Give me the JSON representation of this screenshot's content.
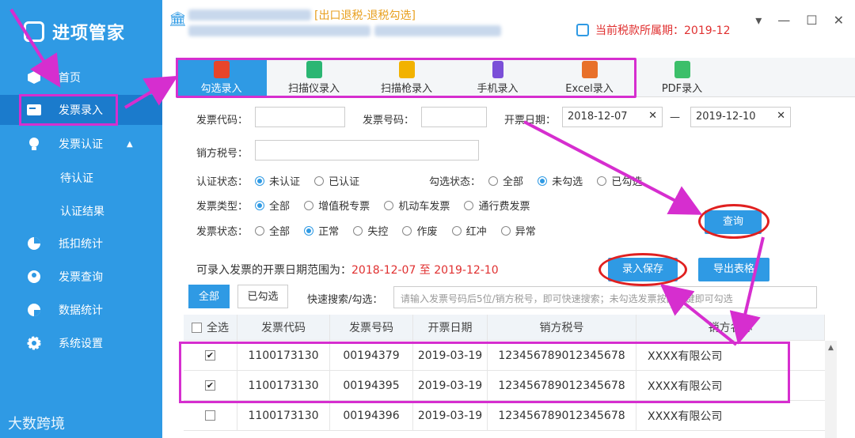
{
  "app": {
    "title": "进项管家",
    "watermark": "大数跨境"
  },
  "sidebar": {
    "items": [
      {
        "label": "首页",
        "icon": "cube-icon"
      },
      {
        "label": "发票录入",
        "icon": "invoice-icon"
      },
      {
        "label": "发票认证",
        "icon": "bulb-icon"
      },
      {
        "label": "待认证"
      },
      {
        "label": "认证结果"
      },
      {
        "label": "抵扣统计",
        "icon": "pie-icon"
      },
      {
        "label": "发票查询",
        "icon": "user-icon"
      },
      {
        "label": "数据统计",
        "icon": "chart-icon"
      },
      {
        "label": "系统设置",
        "icon": "gear-icon"
      }
    ]
  },
  "header": {
    "company_tag": "[出口退税-退税勾选]",
    "period_label": "当前税款所属期：",
    "period_value": "2019-12"
  },
  "tabs": [
    {
      "label": "勾选录入",
      "color": "#e8452a"
    },
    {
      "label": "扫描仪录入",
      "color": "#2bb673"
    },
    {
      "label": "扫描枪录入",
      "color": "#f2b200"
    },
    {
      "label": "手机录入",
      "color": "#7b4fd8"
    },
    {
      "label": "Excel录入",
      "color": "#e8702a"
    },
    {
      "label": "PDF录入",
      "color": "#3cbf6a"
    }
  ],
  "filters": {
    "invoice_code_label": "发票代码：",
    "invoice_no_label": "发票号码：",
    "date_label": "开票日期：",
    "date_from": "2018-12-07",
    "date_to": "2019-12-10",
    "date_sep": "—",
    "seller_tax_label": "销方税号：",
    "auth_status_label": "认证状态：",
    "auth_options": [
      "未认证",
      "已认证"
    ],
    "check_status_label": "勾选状态：",
    "check_options": [
      "全部",
      "未勾选",
      "已勾选"
    ],
    "type_label": "发票类型：",
    "type_options": [
      "全部",
      "增值税专票",
      "机动车发票",
      "通行费发票"
    ],
    "state_label": "发票状态：",
    "state_options": [
      "全部",
      "正常",
      "失控",
      "作废",
      "红冲",
      "异常"
    ],
    "query_button": "查询"
  },
  "range": {
    "label": "可录入发票的开票日期范围为：",
    "value": "2018-12-07 至 2019-12-10"
  },
  "actions": {
    "save": "录入保存",
    "export": "导出表格"
  },
  "subtabs": [
    "全部",
    "已勾选"
  ],
  "quick_search": {
    "label": "快速搜索/勾选：",
    "placeholder": "请输入发票号码后5位/销方税号，即可快速搜索；未勾选发票按回车键即可勾选"
  },
  "table": {
    "headers": [
      "全选",
      "发票代码",
      "发票号码",
      "开票日期",
      "销方税号",
      "销方名称"
    ],
    "rows": [
      {
        "checked": true,
        "code": "1100173130",
        "number": "00194379",
        "date": "2019-03-19",
        "tax": "123456789012345678",
        "name": "XXXX有限公司"
      },
      {
        "checked": true,
        "code": "1100173130",
        "number": "00194395",
        "date": "2019-03-19",
        "tax": "123456789012345678",
        "name": "XXXX有限公司"
      },
      {
        "checked": false,
        "code": "1100173130",
        "number": "00194396",
        "date": "2019-03-19",
        "tax": "123456789012345678",
        "name": "XXXX有限公司"
      }
    ]
  }
}
